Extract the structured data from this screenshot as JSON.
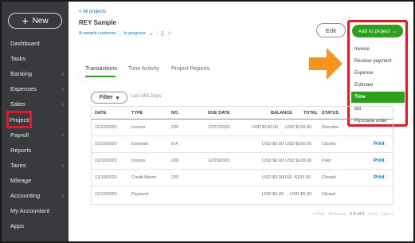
{
  "sidebar": {
    "new_label": "New",
    "items": [
      {
        "label": "Dashboard",
        "chevron": false
      },
      {
        "label": "Tasks",
        "chevron": false
      },
      {
        "label": "Banking",
        "chevron": true
      },
      {
        "label": "Expenses",
        "chevron": true
      },
      {
        "label": "Sales",
        "chevron": true
      },
      {
        "label": "Projects",
        "chevron": false
      },
      {
        "label": "Payroll",
        "chevron": true
      },
      {
        "label": "Reports",
        "chevron": false
      },
      {
        "label": "Taxes",
        "chevron": true
      },
      {
        "label": "Mileage",
        "chevron": false
      },
      {
        "label": "Accounting",
        "chevron": true
      },
      {
        "label": "My Accountant",
        "chevron": false
      },
      {
        "label": "Apps",
        "chevron": false
      }
    ],
    "highlighted_item": "Projects"
  },
  "header": {
    "breadcrumb": "< All projects",
    "title": "REY Sample",
    "customer": "A sample customer",
    "status": "In progress"
  },
  "actions": {
    "edit_label": "Edit",
    "add_label": "Add to project",
    "menu": [
      "Invoice",
      "Receive payment",
      "Expense",
      "Estimate",
      "Time",
      "Bill",
      "Purchase order"
    ],
    "active_item": "Time"
  },
  "tabs": [
    "Transactions",
    "Time Activity",
    "Project Reports"
  ],
  "active_tab": "Transactions",
  "filter": {
    "label": "Filter",
    "note": "Last 365 Days"
  },
  "table": {
    "columns": [
      "DATE",
      "TYPE",
      "NO.",
      "DUE DATE",
      "BALANCE",
      "TOTAL",
      "STATUS"
    ],
    "rows": [
      {
        "date": "12/12/2020",
        "type": "Invoice",
        "no": "230",
        "due": "12/27/2020",
        "balance": "USD $140.00",
        "total": "USD $140.00",
        "status": "Overdue",
        "action": ""
      },
      {
        "date": "12/10/2020",
        "type": "Estimate",
        "no": "8-A",
        "due": "",
        "balance": "USD $0.00",
        "total": "USD $100.00",
        "status": "Closed",
        "action": "Print"
      },
      {
        "date": "12/10/2020",
        "type": "Invoice",
        "no": "228",
        "due": "12/25/2020",
        "balance": "USD $0.00",
        "total": "USD $100.00",
        "status": "Paid",
        "action": "Print"
      },
      {
        "date": "12/10/2020",
        "type": "Credit Memo",
        "no": "229",
        "due": "",
        "balance": "USD $0.00",
        "total": "USD -$100.00",
        "status": "Closed",
        "action": "Print"
      },
      {
        "date": "12/10/2020",
        "type": "Payment",
        "no": "",
        "due": "",
        "balance": "USD $0.00",
        "total": "USD $0.00",
        "status": "Closed",
        "action": ""
      }
    ]
  },
  "pager": {
    "first": "< First",
    "prev": "Previous",
    "range": "1-5 of 5",
    "next": "Next",
    "last": "Last >"
  },
  "colors": {
    "sidebar_bg": "#393a3d",
    "accent_green": "#2ca01c",
    "highlight_red": "#e01b24",
    "link_blue": "#0077c5",
    "arrow_orange": "#f7941d"
  }
}
